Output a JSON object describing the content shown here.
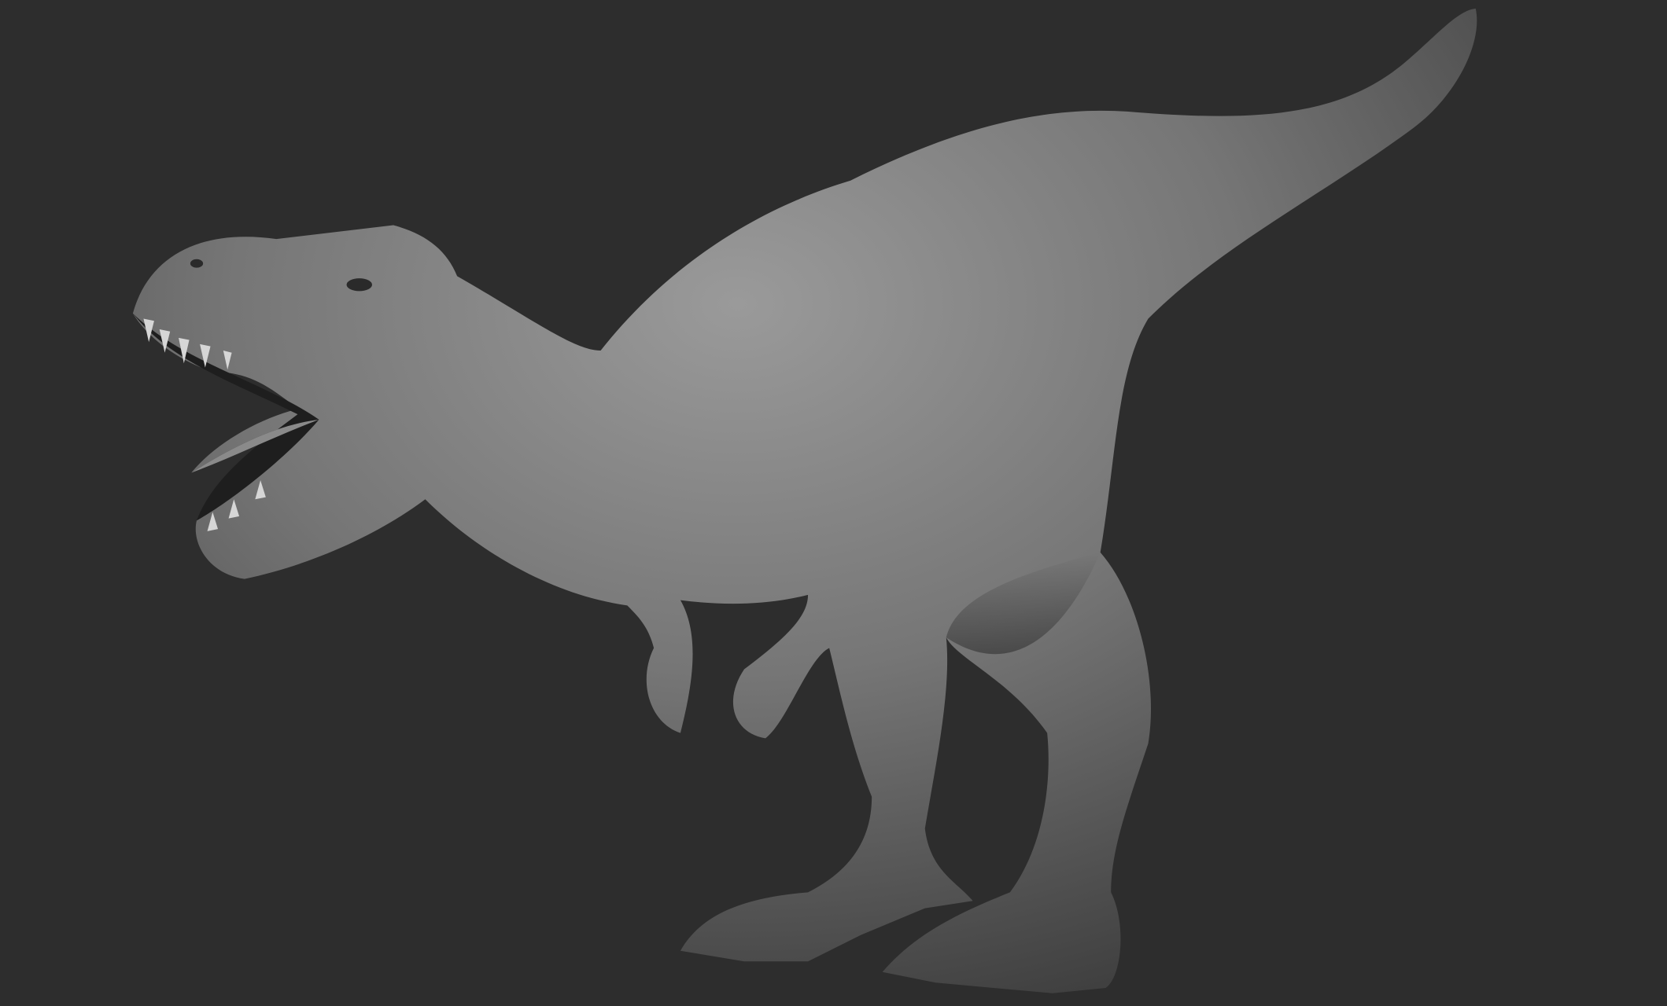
{
  "scene": {
    "subject": "tyrannosaurus-sculpt",
    "colors": {
      "background": "#2d2d2d",
      "body_light": "#9a9a9a",
      "body_mid": "#6e6e6e",
      "body_dark": "#3a3a3a",
      "mouth": "#1e1e1e",
      "teeth": "#d6d6d6"
    }
  }
}
